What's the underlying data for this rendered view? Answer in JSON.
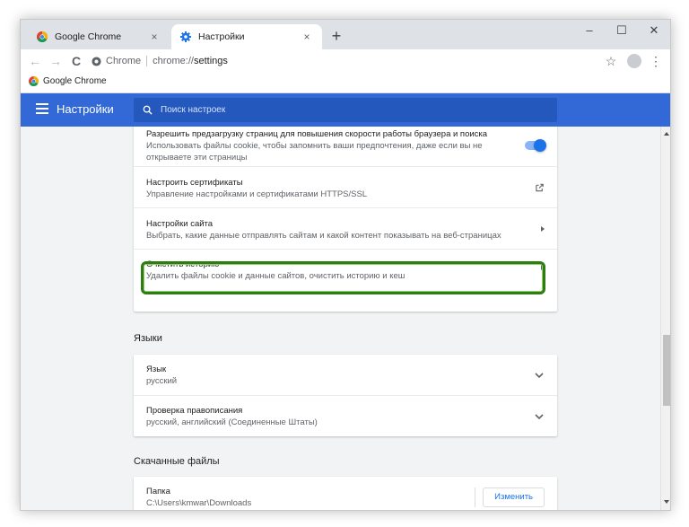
{
  "tabs": [
    {
      "title": "Google Chrome",
      "close": "×"
    },
    {
      "title": "Настройки",
      "close": "×"
    }
  ],
  "new_tab": "+",
  "window_controls": {
    "minimize": "–",
    "maximize": "☐",
    "close": "✕"
  },
  "toolbar": {
    "back": "←",
    "forward": "→",
    "reload": "C",
    "chip": "Chrome",
    "url_scheme": "chrome://",
    "url_path": "settings",
    "star": "☆",
    "menu": "⋮"
  },
  "bookmarks": [
    {
      "label": "Google Chrome"
    }
  ],
  "settings_header": {
    "title": "Настройки",
    "search_placeholder": "Поиск настроек"
  },
  "privacy_card": {
    "rows": [
      {
        "label": "Разрешить предзагрузку страниц для повышения скорости работы браузера и поиска",
        "sub": "Использовать файлы cookie, чтобы запомнить ваши предпочтения, даже если вы не открываете эти страницы",
        "control": "toggle",
        "enabled": true
      },
      {
        "label": "Настроить сертификаты",
        "sub": "Управление настройками и сертификатами HTTPS/SSL",
        "control": "external-link"
      },
      {
        "label": "Настройки сайта",
        "sub": "Выбрать, какие данные отправлять сайтам и какой контент показывать на веб-страницах",
        "control": "arrow"
      },
      {
        "label": "Очистить историю",
        "sub": "Удалить файлы cookie и данные сайтов, очистить историю и кеш",
        "control": "arrow",
        "highlighted": true
      }
    ]
  },
  "languages": {
    "title": "Языки",
    "rows": [
      {
        "label": "Язык",
        "sub": "русский"
      },
      {
        "label": "Проверка правописания",
        "sub": "русский, английский (Соединенные Штаты)"
      }
    ]
  },
  "downloads": {
    "title": "Скачанные файлы",
    "rows": [
      {
        "label": "Папка",
        "sub": "C:\\Users\\kmwar\\Downloads",
        "button": "Изменить"
      }
    ]
  },
  "colors": {
    "header_bg": "#3269d6",
    "search_bg": "#2558bd",
    "toggle_on": "#1a73e8",
    "highlight_border": "#2f7d12",
    "link_blue": "#1a73e8"
  }
}
